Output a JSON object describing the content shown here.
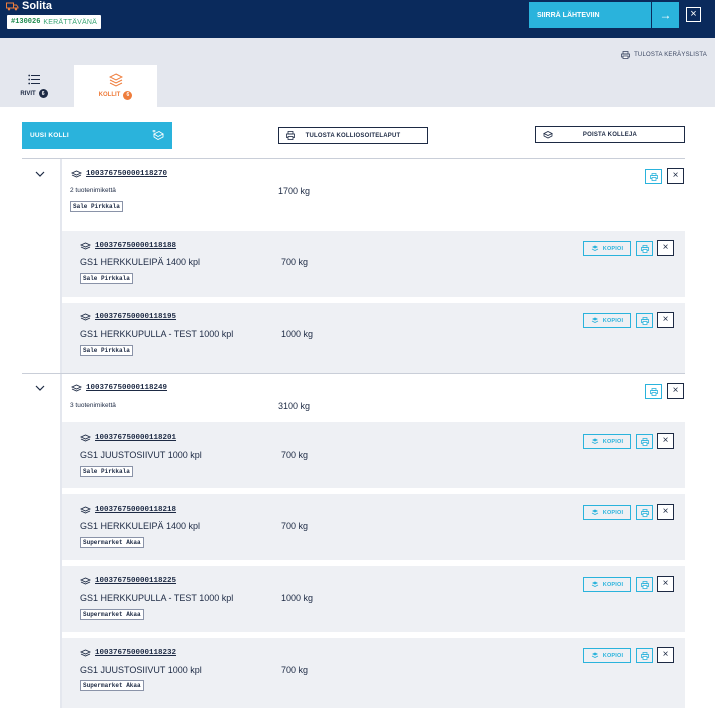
{
  "app": {
    "brand": "Solita",
    "order_number": "#130026",
    "order_status": "KERÄTTÄVÄNÄ",
    "move_button": "SIIRRÄ LÄHTEVIIN",
    "move_arrow": "→",
    "close": "×"
  },
  "toolbar": {
    "print_list": "TULOSTA KERÄYSLISTA"
  },
  "tabs": [
    {
      "label": "RIVIT",
      "count": "6"
    },
    {
      "label": "KOLLIT",
      "count": "6"
    }
  ],
  "actions": {
    "new_package": "UUSI KOLLI",
    "print_labels": "TULOSTA KOLLIOSOITELAPUT",
    "delete_packages": "POISTA KOLLEJA"
  },
  "row_buttons": {
    "copy": "KOPIOI",
    "remove": "×"
  },
  "groups": [
    {
      "id": "100376750000118270",
      "summary": "2 tuotenimikettä",
      "weight": "1700 kg",
      "tag": "Sale Pirkkala",
      "items": [
        {
          "id": "100376750000118188",
          "name": "GS1 HERKKULEIPÄ 1400 kpl",
          "weight": "700 kg",
          "tag": "Sale Pirkkala"
        },
        {
          "id": "100376750000118195",
          "name": "GS1 HERKKUPULLA - TEST 1000 kpl",
          "weight": "1000 kg",
          "tag": "Sale Pirkkala"
        }
      ]
    },
    {
      "id": "100376750000118249",
      "summary": "3 tuotenimikettä",
      "weight": "3100 kg",
      "items": [
        {
          "id": "100376750000118201",
          "name": "GS1 JUUSTOSIIVUT 1000 kpl",
          "weight": "700 kg",
          "tag": "Sale Pirkkala"
        },
        {
          "id": "100376750000118218",
          "name": "GS1 HERKKULEIPÄ 1400 kpl",
          "weight": "700 kg",
          "tag": "Supermarket Akaa"
        },
        {
          "id": "100376750000118225",
          "name": "GS1 HERKKUPULLA - TEST 1000 kpl",
          "weight": "1000 kg",
          "tag": "Supermarket Akaa"
        },
        {
          "id": "100376750000118232",
          "name": "GS1 JUUSTOSIIVUT 1000 kpl",
          "weight": "700 kg",
          "tag": "Supermarket Akaa"
        }
      ]
    }
  ],
  "colors": {
    "navy": "#0a2a5c",
    "accent": "#2ab3dc",
    "orange": "#ef7d3c",
    "green": "#1e8a4e"
  }
}
